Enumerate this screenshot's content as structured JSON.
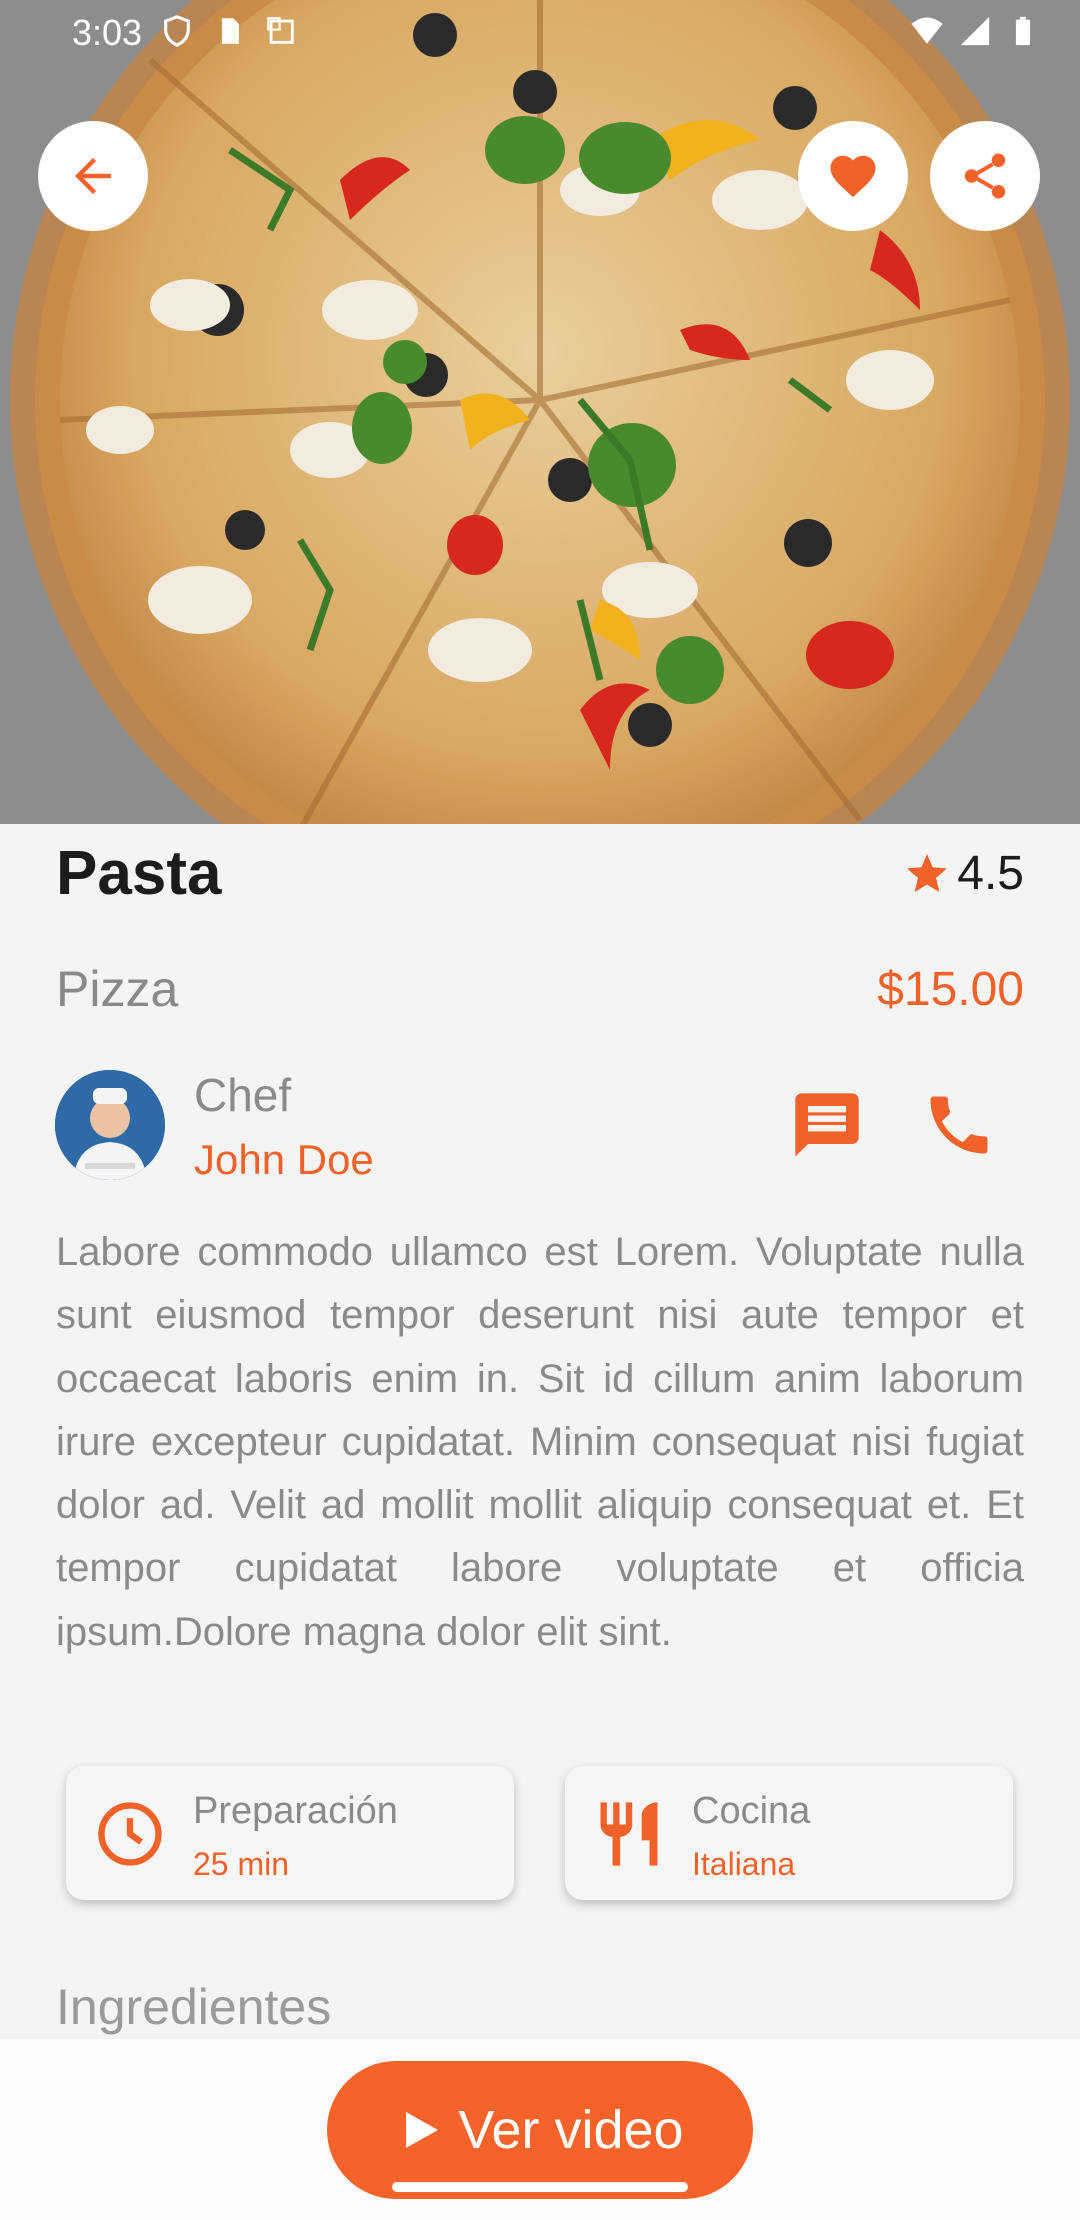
{
  "status_bar": {
    "time": "3:03"
  },
  "hero": {
    "image": "pizza-photo"
  },
  "actions": {
    "back_icon": "arrow-back-icon",
    "favorite_icon": "heart-icon",
    "share_icon": "share-icon"
  },
  "recipe": {
    "title": "Pasta",
    "rating": "4.5",
    "category": "Pizza",
    "price": "$15.00",
    "chef_role": "Chef",
    "chef_name": "John Doe",
    "description": "Labore commodo ullamco est Lorem. Voluptate nulla sunt eiusmod tempor deserunt nisi aute tempor et occaecat laboris enim in. Sit id cillum anim laborum irure excepteur cupidatat. Minim consequat nisi fugiat dolor ad. Velit ad mollit mollit aliquip consequat et. Et tempor cupidatat labore voluptate et officia ipsum.Dolore magna dolor elit sint."
  },
  "info_cards": [
    {
      "title": "Preparación",
      "value": "25 min",
      "icon": "clock-icon"
    },
    {
      "title": "Cocina",
      "value": "Italiana",
      "icon": "restaurant-icon"
    }
  ],
  "ingredients_title": "Ingredientes",
  "video_button": {
    "label": "Ver video",
    "icon": "play-icon"
  },
  "colors": {
    "accent": "#f0622a",
    "button": "#f5622a",
    "background": "#f4f4f4",
    "muted_text": "#8a8a8a"
  }
}
